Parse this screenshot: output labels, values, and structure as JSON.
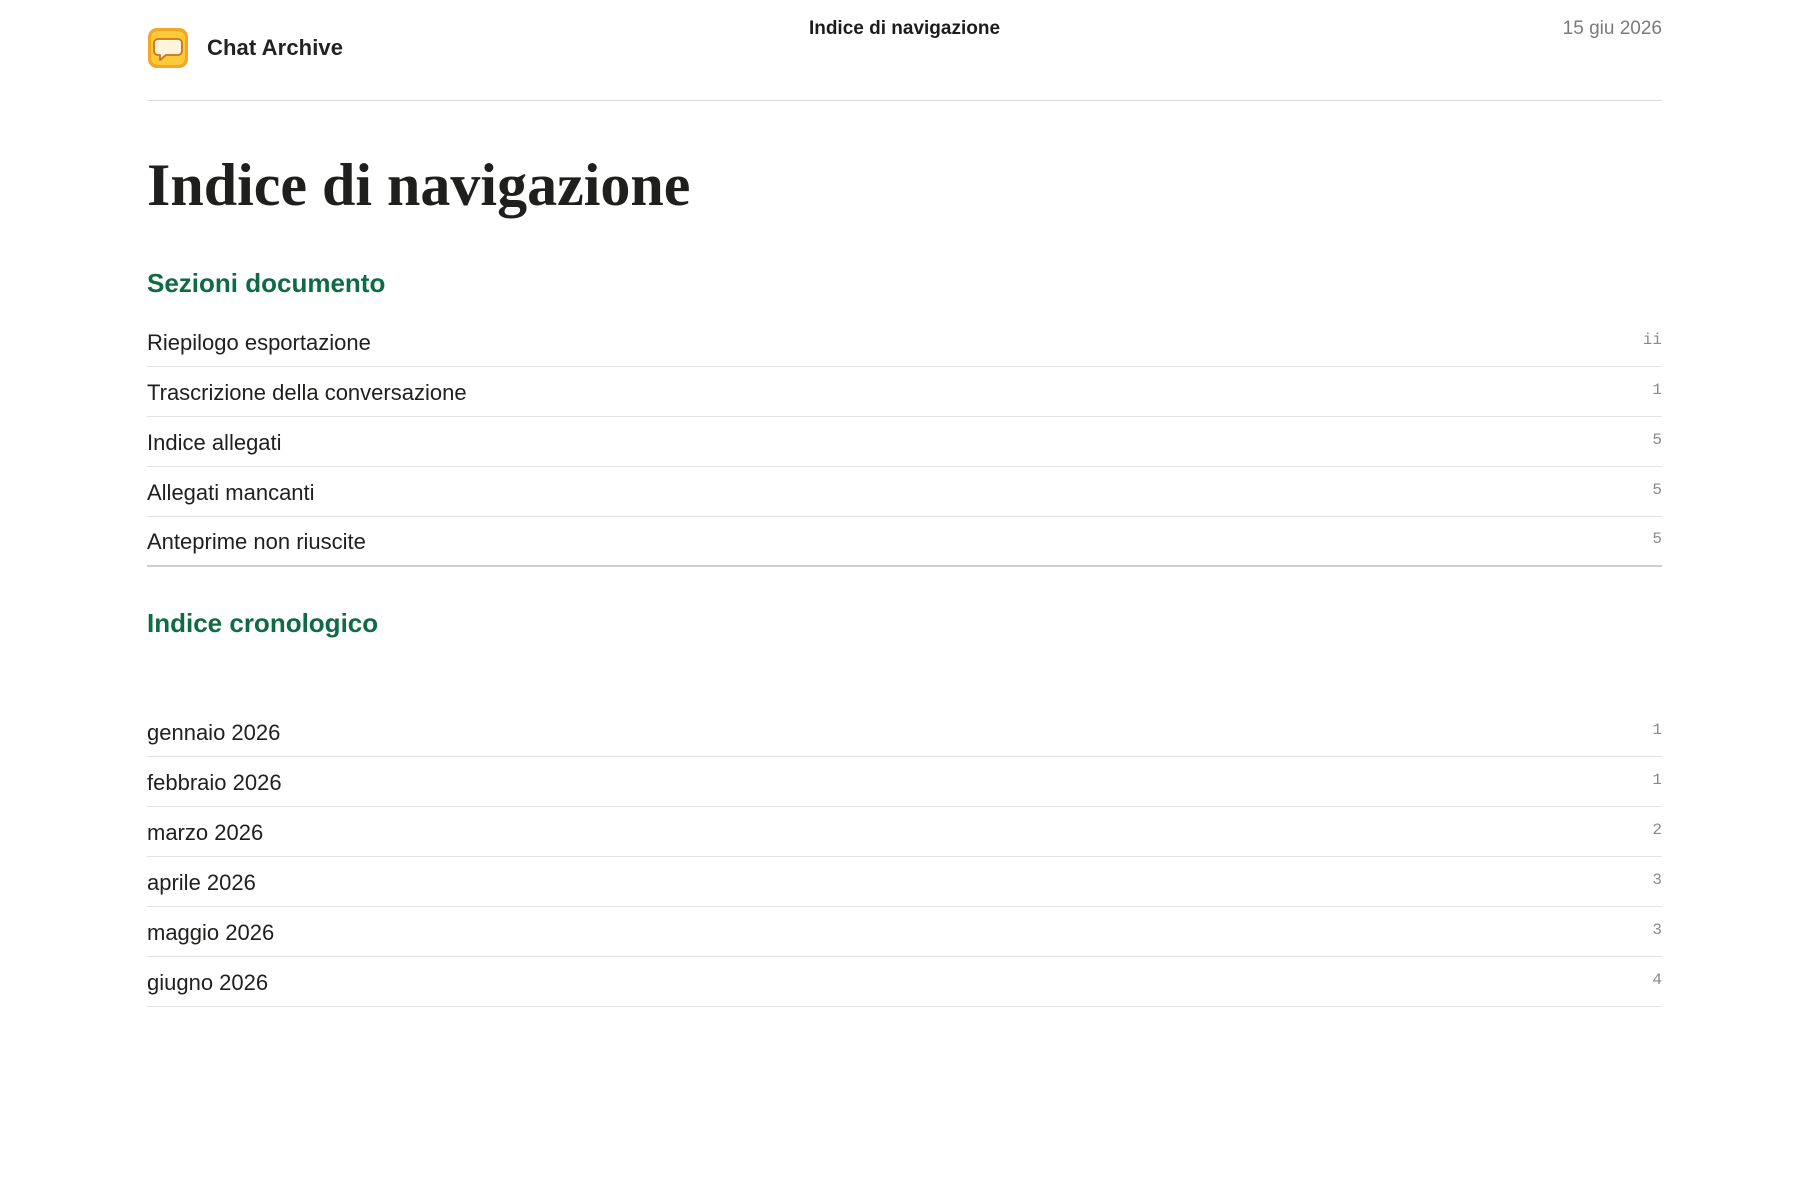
{
  "header": {
    "app_name": "Chat Archive",
    "title": "Indice di navigazione",
    "date": "15 giu 2026",
    "app_icon": "chat-bubble-icon",
    "icon_colors": {
      "outer": "#f5a623",
      "inner": "#ffd35a",
      "bubble": "#ffffff"
    }
  },
  "main": {
    "title": "Indice di navigazione",
    "sections": {
      "heading": "Sezioni documento",
      "items": [
        {
          "label": "Riepilogo esportazione",
          "page": "ii"
        },
        {
          "label": "Trascrizione della conversazione",
          "page": "1"
        },
        {
          "label": "Indice allegati",
          "page": "5"
        },
        {
          "label": "Allegati mancanti",
          "page": "5"
        },
        {
          "label": "Anteprime non riuscite",
          "page": "5"
        }
      ]
    },
    "chronological": {
      "heading": "Indice cronologico",
      "items": [
        {
          "label": "gennaio 2026",
          "page": "1"
        },
        {
          "label": "febbraio 2026",
          "page": "1"
        },
        {
          "label": "marzo 2026",
          "page": "2"
        },
        {
          "label": "aprile 2026",
          "page": "3"
        },
        {
          "label": "maggio 2026",
          "page": "3"
        },
        {
          "label": "giugno 2026",
          "page": "4"
        }
      ]
    }
  },
  "colors": {
    "heading_accent": "#0f6b45",
    "text": "#1f1f1d",
    "muted": "#7a7a7a",
    "divider": "#e2e2e2"
  }
}
